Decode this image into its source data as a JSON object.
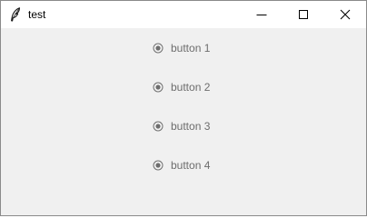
{
  "window": {
    "title": "test",
    "app_icon": "feather-icon",
    "controls": [
      "minimize-icon",
      "maximize-icon",
      "close-icon"
    ]
  },
  "radio_group": {
    "items": [
      {
        "label": "button 1",
        "state": "indeterminate",
        "enabled": false
      },
      {
        "label": "button 2",
        "state": "indeterminate",
        "enabled": false
      },
      {
        "label": "button 3",
        "state": "indeterminate",
        "enabled": false
      },
      {
        "label": "button 4",
        "state": "indeterminate",
        "enabled": false
      }
    ]
  },
  "colors": {
    "client_bg": "#f0f0f0",
    "titlebar_bg": "#ffffff",
    "disabled_text": "#6d6d6d"
  }
}
